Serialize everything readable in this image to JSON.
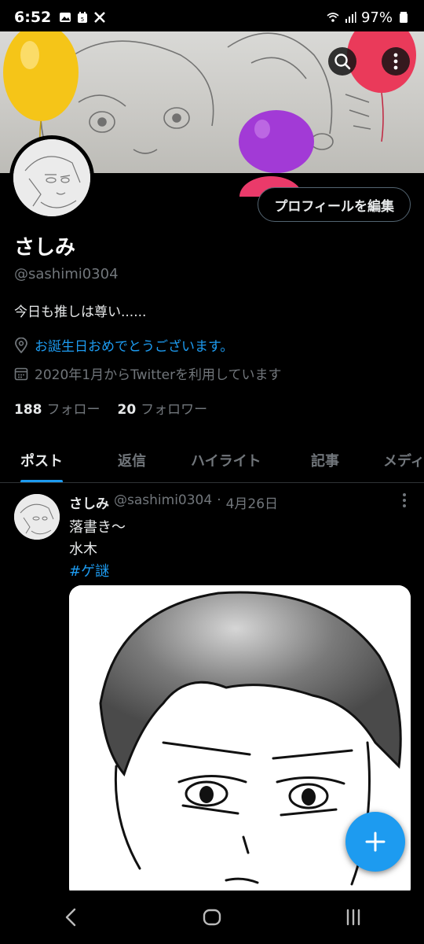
{
  "status_bar": {
    "time": "6:52",
    "battery": "97%"
  },
  "profile": {
    "name": "さしみ",
    "handle": "@sashimi0304",
    "bio": "今日も推しは尊い......",
    "location": "お誕生日おめでとうございます。",
    "joined": "2020年1月からTwitterを利用しています",
    "following_count": "188",
    "following_label": "フォロー",
    "followers_count": "20",
    "followers_label": "フォロワー",
    "edit_button": "プロフィールを編集"
  },
  "tabs": [
    {
      "label": "ポスト"
    },
    {
      "label": "返信"
    },
    {
      "label": "ハイライト"
    },
    {
      "label": "記事"
    },
    {
      "label": "メディア"
    }
  ],
  "post": {
    "author": "さしみ",
    "handle": "@sashimi0304",
    "separator": "·",
    "date": "4月26日",
    "lines": [
      "落書き〜",
      "水木"
    ],
    "hashtag": "#ゲ謎"
  },
  "colors": {
    "accent": "#1d9bf0",
    "background": "#000000",
    "muted": "#71767b"
  },
  "icons": [
    "search-icon",
    "more-icon",
    "location-icon",
    "calendar-icon",
    "plus-icon",
    "back-icon",
    "home-icon",
    "recents-icon"
  ]
}
